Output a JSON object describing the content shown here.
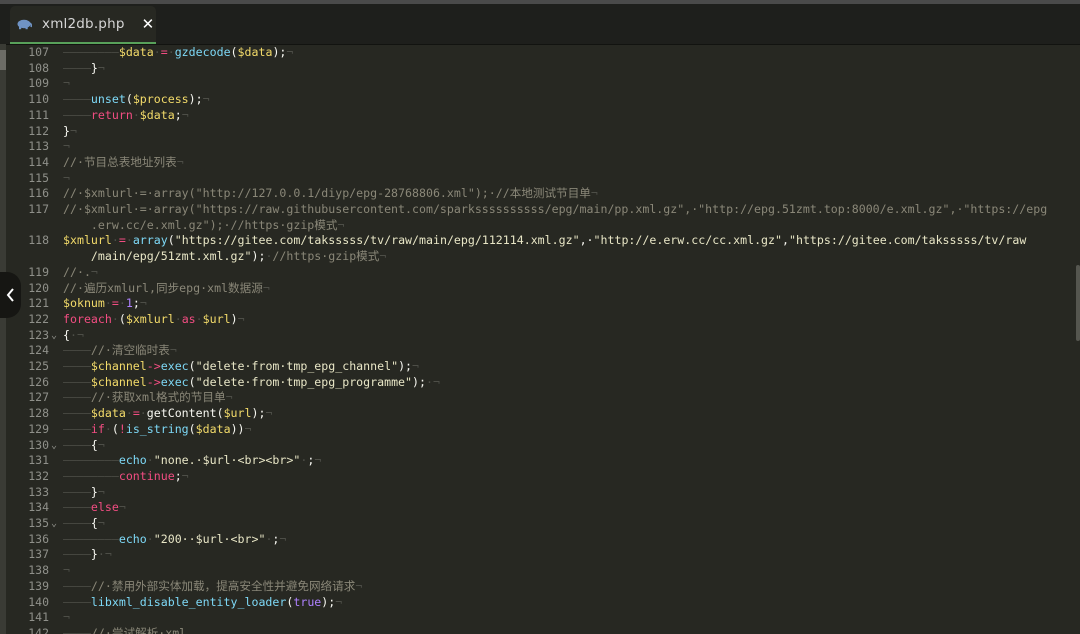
{
  "tab": {
    "title": "xml2db.php",
    "close": "✕",
    "icon": "elephant-php-icon"
  },
  "colors": {
    "background": "#272822",
    "keyword": "#f24d82",
    "variable": "#f3db6a",
    "function": "#7ed9f7",
    "comment": "#8a8778",
    "string": "#e8e6c6",
    "number": "#ae81ff",
    "whitespace": "#4d4e47",
    "tab_accent": "#58a15a"
  },
  "lines": [
    {
      "n": "107",
      "fold": "",
      "segs": [
        [
          "ws",
          "————————"
        ],
        [
          "vr",
          "$data"
        ],
        [
          "ws",
          "·"
        ],
        [
          "op",
          "="
        ],
        [
          "ws",
          "·"
        ],
        [
          "fn",
          "gzdecode"
        ],
        [
          "pl",
          "("
        ],
        [
          "vr",
          "$data"
        ],
        [
          "pl",
          ");"
        ],
        [
          "ws",
          "¬"
        ]
      ]
    },
    {
      "n": "108",
      "fold": "",
      "segs": [
        [
          "ws",
          "————"
        ],
        [
          "pl",
          "}"
        ],
        [
          "ws",
          "¬"
        ]
      ]
    },
    {
      "n": "109",
      "fold": "",
      "segs": [
        [
          "ws",
          "¬"
        ]
      ]
    },
    {
      "n": "110",
      "fold": "",
      "segs": [
        [
          "ws",
          "————"
        ],
        [
          "fn",
          "unset"
        ],
        [
          "pl",
          "("
        ],
        [
          "vr",
          "$process"
        ],
        [
          "pl",
          ");"
        ],
        [
          "ws",
          "¬"
        ]
      ]
    },
    {
      "n": "111",
      "fold": "",
      "segs": [
        [
          "ws",
          "————"
        ],
        [
          "kw",
          "return"
        ],
        [
          "ws",
          "·"
        ],
        [
          "vr",
          "$data"
        ],
        [
          "pl",
          ";"
        ],
        [
          "ws",
          "¬"
        ]
      ]
    },
    {
      "n": "112",
      "fold": "",
      "segs": [
        [
          "pl",
          "}"
        ],
        [
          "ws",
          "¬"
        ]
      ]
    },
    {
      "n": "113",
      "fold": "",
      "segs": [
        [
          "ws",
          "¬"
        ]
      ]
    },
    {
      "n": "114",
      "fold": "",
      "segs": [
        [
          "cm",
          "//·节目总表地址列表"
        ],
        [
          "ws",
          "¬"
        ]
      ]
    },
    {
      "n": "115",
      "fold": "",
      "segs": [
        [
          "ws",
          "¬"
        ]
      ]
    },
    {
      "n": "116",
      "fold": "",
      "segs": [
        [
          "cm",
          "//·$xmlurl·=·array(\"http://127.0.0.1/diyp/epg-28768806.xml\");·//本地测试节目单"
        ],
        [
          "ws",
          "¬"
        ]
      ]
    },
    {
      "n": "117",
      "fold": "",
      "segs": [
        [
          "cm",
          "//·$xmlurl·=·array(\"https://raw.githubusercontent.com/sparkssssssssss/epg/main/pp.xml.gz\",·\"http://epg.51zmt.top:8000/e.xml.gz\",·\"https://epg"
        ]
      ]
    },
    {
      "n": "",
      "fold": "",
      "segs": [
        [
          "cm",
          "    .erw.cc/e.xml.gz\");·//https·gzip模式"
        ],
        [
          "ws",
          "¬"
        ]
      ]
    },
    {
      "n": "118",
      "fold": "",
      "segs": [
        [
          "vr",
          "$xmlurl"
        ],
        [
          "ws",
          "·"
        ],
        [
          "op",
          "="
        ],
        [
          "ws",
          "·"
        ],
        [
          "fn",
          "array"
        ],
        [
          "pl",
          "("
        ],
        [
          "st",
          "\"https://gitee.com/taksssss/tv/raw/main/epg/112114.xml.gz\""
        ],
        [
          "pl",
          ",·"
        ],
        [
          "st",
          "\"http://e.erw.cc/cc.xml.gz\""
        ],
        [
          "pl",
          ","
        ],
        [
          "st",
          "\"https://gitee.com/taksssss/tv/raw"
        ]
      ]
    },
    {
      "n": "",
      "fold": "",
      "segs": [
        [
          "st",
          "    /main/epg/51zmt.xml.gz\""
        ],
        [
          "pl",
          ");"
        ],
        [
          "ws",
          "·"
        ],
        [
          "cm",
          "//https·gzip模式"
        ],
        [
          "ws",
          "¬"
        ]
      ]
    },
    {
      "n": "119",
      "fold": "",
      "segs": [
        [
          "cm",
          "//·."
        ],
        [
          "ws",
          "¬"
        ]
      ]
    },
    {
      "n": "120",
      "fold": "",
      "segs": [
        [
          "cm",
          "//·遍历xmlurl,同步epg·xml数据源"
        ],
        [
          "ws",
          "¬"
        ]
      ]
    },
    {
      "n": "121",
      "fold": "",
      "segs": [
        [
          "vr",
          "$oknum"
        ],
        [
          "ws",
          "·"
        ],
        [
          "op",
          "="
        ],
        [
          "ws",
          "·"
        ],
        [
          "nm",
          "1"
        ],
        [
          "pl",
          ";"
        ],
        [
          "ws",
          "¬"
        ]
      ]
    },
    {
      "n": "122",
      "fold": "",
      "segs": [
        [
          "kw",
          "foreach"
        ],
        [
          "ws",
          "·"
        ],
        [
          "pl",
          "("
        ],
        [
          "vr",
          "$xmlurl"
        ],
        [
          "ws",
          "·"
        ],
        [
          "kw",
          "as"
        ],
        [
          "ws",
          "·"
        ],
        [
          "vr",
          "$url"
        ],
        [
          "pl",
          ")"
        ],
        [
          "ws",
          "¬"
        ]
      ]
    },
    {
      "n": "123",
      "fold": "⌄",
      "segs": [
        [
          "pl",
          "{"
        ],
        [
          "ws",
          "·¬"
        ]
      ]
    },
    {
      "n": "124",
      "fold": "",
      "segs": [
        [
          "ws",
          "————"
        ],
        [
          "cm",
          "//·清空临时表"
        ],
        [
          "ws",
          "¬"
        ]
      ]
    },
    {
      "n": "125",
      "fold": "",
      "segs": [
        [
          "ws",
          "————"
        ],
        [
          "vr",
          "$channel"
        ],
        [
          "op",
          "->"
        ],
        [
          "fn",
          "exec"
        ],
        [
          "pl",
          "("
        ],
        [
          "st",
          "\"delete·from·tmp_epg_channel\""
        ],
        [
          "pl",
          ");"
        ],
        [
          "ws",
          "¬"
        ]
      ]
    },
    {
      "n": "126",
      "fold": "",
      "segs": [
        [
          "ws",
          "————"
        ],
        [
          "vr",
          "$channel"
        ],
        [
          "op",
          "->"
        ],
        [
          "fn",
          "exec"
        ],
        [
          "pl",
          "("
        ],
        [
          "st",
          "\"delete·from·tmp_epg_programme\""
        ],
        [
          "pl",
          ");"
        ],
        [
          "ws",
          "·¬"
        ]
      ]
    },
    {
      "n": "127",
      "fold": "",
      "segs": [
        [
          "ws",
          "————"
        ],
        [
          "cm",
          "//·获取xml格式的节目单"
        ],
        [
          "ws",
          "¬"
        ]
      ]
    },
    {
      "n": "128",
      "fold": "",
      "segs": [
        [
          "ws",
          "————"
        ],
        [
          "vr",
          "$data"
        ],
        [
          "ws",
          "·"
        ],
        [
          "op",
          "="
        ],
        [
          "ws",
          "·"
        ],
        [
          "pl",
          "getContent("
        ],
        [
          "vr",
          "$url"
        ],
        [
          "pl",
          ");"
        ],
        [
          "ws",
          "¬"
        ]
      ]
    },
    {
      "n": "129",
      "fold": "",
      "segs": [
        [
          "ws",
          "————"
        ],
        [
          "kw",
          "if"
        ],
        [
          "ws",
          "·"
        ],
        [
          "pl",
          "("
        ],
        [
          "op",
          "!"
        ],
        [
          "fn",
          "is_string"
        ],
        [
          "pl",
          "("
        ],
        [
          "vr",
          "$data"
        ],
        [
          "pl",
          "))"
        ],
        [
          "ws",
          "¬"
        ]
      ]
    },
    {
      "n": "130",
      "fold": "⌄",
      "segs": [
        [
          "ws",
          "————"
        ],
        [
          "pl",
          "{"
        ],
        [
          "ws",
          "¬"
        ]
      ]
    },
    {
      "n": "131",
      "fold": "",
      "segs": [
        [
          "ws",
          "————————"
        ],
        [
          "fn",
          "echo"
        ],
        [
          "ws",
          "·"
        ],
        [
          "st",
          "\"none.·$url·<br><br>\""
        ],
        [
          "ws",
          "·"
        ],
        [
          "pl",
          ";"
        ],
        [
          "ws",
          "¬"
        ]
      ]
    },
    {
      "n": "132",
      "fold": "",
      "segs": [
        [
          "ws",
          "————————"
        ],
        [
          "kw",
          "continue"
        ],
        [
          "pl",
          ";"
        ],
        [
          "ws",
          "¬"
        ]
      ]
    },
    {
      "n": "133",
      "fold": "",
      "segs": [
        [
          "ws",
          "————"
        ],
        [
          "pl",
          "}"
        ],
        [
          "ws",
          "¬"
        ]
      ]
    },
    {
      "n": "134",
      "fold": "",
      "segs": [
        [
          "ws",
          "————"
        ],
        [
          "kw",
          "else"
        ],
        [
          "ws",
          "¬"
        ]
      ]
    },
    {
      "n": "135",
      "fold": "⌄",
      "segs": [
        [
          "ws",
          "————"
        ],
        [
          "pl",
          "{"
        ],
        [
          "ws",
          "¬"
        ]
      ]
    },
    {
      "n": "136",
      "fold": "",
      "segs": [
        [
          "ws",
          "————————"
        ],
        [
          "fn",
          "echo"
        ],
        [
          "ws",
          "·"
        ],
        [
          "st",
          "\"200··$url·<br>\""
        ],
        [
          "ws",
          "·"
        ],
        [
          "pl",
          ";"
        ],
        [
          "ws",
          "¬"
        ]
      ]
    },
    {
      "n": "137",
      "fold": "",
      "segs": [
        [
          "ws",
          "————"
        ],
        [
          "pl",
          "}"
        ],
        [
          "ws",
          "·¬"
        ]
      ]
    },
    {
      "n": "138",
      "fold": "",
      "segs": [
        [
          "ws",
          "¬"
        ]
      ]
    },
    {
      "n": "139",
      "fold": "",
      "segs": [
        [
          "ws",
          "————"
        ],
        [
          "cm",
          "//·禁用外部实体加载，提高安全性并避免网络请求"
        ],
        [
          "ws",
          "¬"
        ]
      ]
    },
    {
      "n": "140",
      "fold": "",
      "segs": [
        [
          "ws",
          "————"
        ],
        [
          "fn",
          "libxml_disable_entity_loader"
        ],
        [
          "pl",
          "("
        ],
        [
          "nm",
          "true"
        ],
        [
          "pl",
          ");"
        ],
        [
          "ws",
          "¬"
        ]
      ]
    },
    {
      "n": "141",
      "fold": "",
      "segs": [
        [
          "ws",
          "¬"
        ]
      ]
    },
    {
      "n": "142",
      "fold": "",
      "segs": [
        [
          "ws",
          "————"
        ],
        [
          "cm",
          "//·尝试解析·xml"
        ]
      ]
    }
  ]
}
